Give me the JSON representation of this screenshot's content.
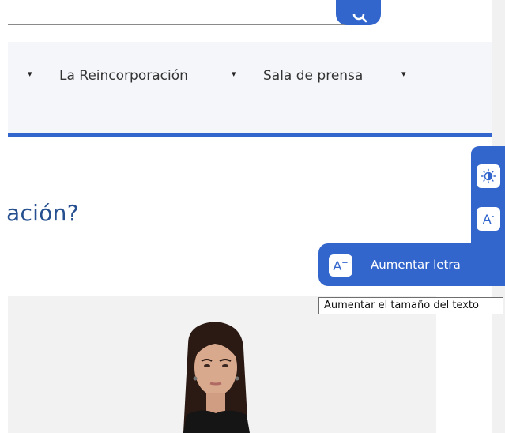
{
  "nav": {
    "items": [
      {
        "label": "La Reincorporación"
      },
      {
        "label": "Sala de prensa"
      }
    ],
    "caret": "▾"
  },
  "main": {
    "heading_fragment": "ación?"
  },
  "accessibility": {
    "contrast_icon": "contrast-icon",
    "decrease_label": "A",
    "decrease_sup": "-",
    "increase_label": "A",
    "increase_sup": "+",
    "increase_text": "Aumentar letra",
    "increase_tooltip": "Aumentar el tamaño del texto"
  },
  "colors": {
    "accent": "#3366cc",
    "heading": "#254f8f",
    "nav_bg": "#f5f6f9"
  }
}
